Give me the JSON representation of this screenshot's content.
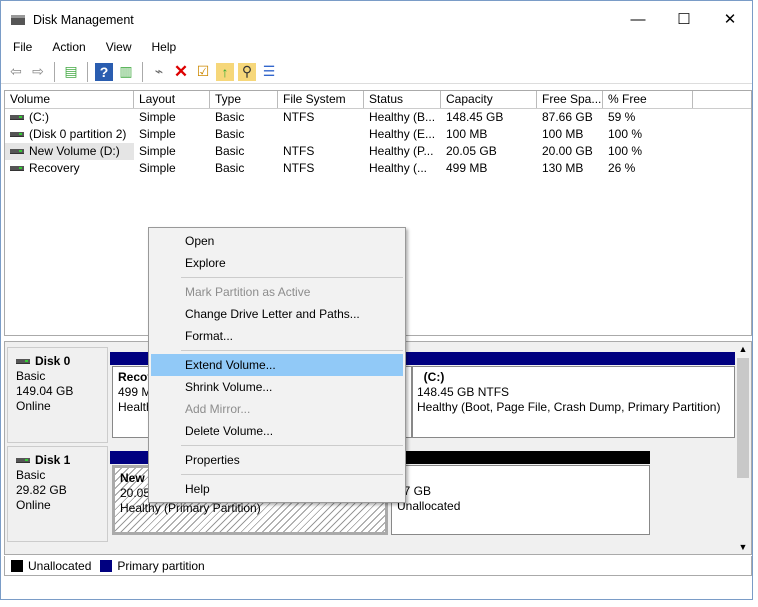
{
  "window": {
    "title": "Disk Management",
    "minimize": "—",
    "maximize": "☐",
    "close": "✕"
  },
  "menu": [
    "File",
    "Action",
    "View",
    "Help"
  ],
  "toolbar": [
    "back-icon",
    "forward-icon",
    "console-tree-icon",
    "help-icon",
    "show-pane-icon",
    "connect-disk-icon",
    "delete-icon",
    "check-icon",
    "folder-up-icon",
    "search-folder-icon",
    "properties-icon"
  ],
  "columns": [
    "Volume",
    "Layout",
    "Type",
    "File System",
    "Status",
    "Capacity",
    "Free Spa...",
    "% Free"
  ],
  "volumes": [
    [
      "(C:)",
      "Simple",
      "Basic",
      "NTFS",
      "Healthy (B...",
      "148.45 GB",
      "87.66 GB",
      "59 %"
    ],
    [
      "(Disk 0 partition 2)",
      "Simple",
      "Basic",
      "",
      "Healthy (E...",
      "100 MB",
      "100 MB",
      "100 %"
    ],
    [
      "New Volume (D:)",
      "Simple",
      "Basic",
      "NTFS",
      "Healthy (P...",
      "20.05 GB",
      "20.00 GB",
      "100 %"
    ],
    [
      "Recovery",
      "Simple",
      "Basic",
      "NTFS",
      "Healthy (...",
      "499 MB",
      "130 MB",
      "26 %"
    ]
  ],
  "disks": [
    {
      "name": "Disk 0",
      "type": "Basic",
      "size": "149.04 GB",
      "status": "Online",
      "parts": [
        {
          "title": "Recov",
          "size": "499 M",
          "status": "Health"
        },
        {
          "title": "(C:)",
          "size": "148.45 GB NTFS",
          "status": "Healthy (Boot, Page File, Crash Dump, Primary Partition)"
        }
      ]
    },
    {
      "name": "Disk 1",
      "type": "Basic",
      "size": "29.82 GB",
      "status": "Online",
      "parts": [
        {
          "title": "New V",
          "size": "20.05 (",
          "status": "Healthy (Primary Partition)"
        },
        {
          "title": "",
          "size": "77 GB",
          "status": "Unallocated"
        }
      ]
    }
  ],
  "legend": [
    {
      "label": "Unallocated",
      "color": "#000000"
    },
    {
      "label": "Primary partition",
      "color": "#000080"
    }
  ],
  "context_menu": {
    "items": [
      {
        "label": "Open",
        "enabled": true
      },
      {
        "label": "Explore",
        "enabled": true
      },
      {
        "label": "Mark Partition as Active",
        "enabled": false
      },
      {
        "label": "Change Drive Letter and Paths...",
        "enabled": true
      },
      {
        "label": "Format...",
        "enabled": true
      },
      {
        "label": "Extend Volume...",
        "enabled": true,
        "highlighted": true
      },
      {
        "label": "Shrink Volume...",
        "enabled": true
      },
      {
        "label": "Add Mirror...",
        "enabled": false
      },
      {
        "label": "Delete Volume...",
        "enabled": true
      },
      {
        "label": "Properties",
        "enabled": true
      },
      {
        "label": "Help",
        "enabled": true
      }
    ]
  },
  "colors": {
    "primary": "#000080",
    "unallocated": "#000000",
    "highlight": "#91c9f7"
  }
}
